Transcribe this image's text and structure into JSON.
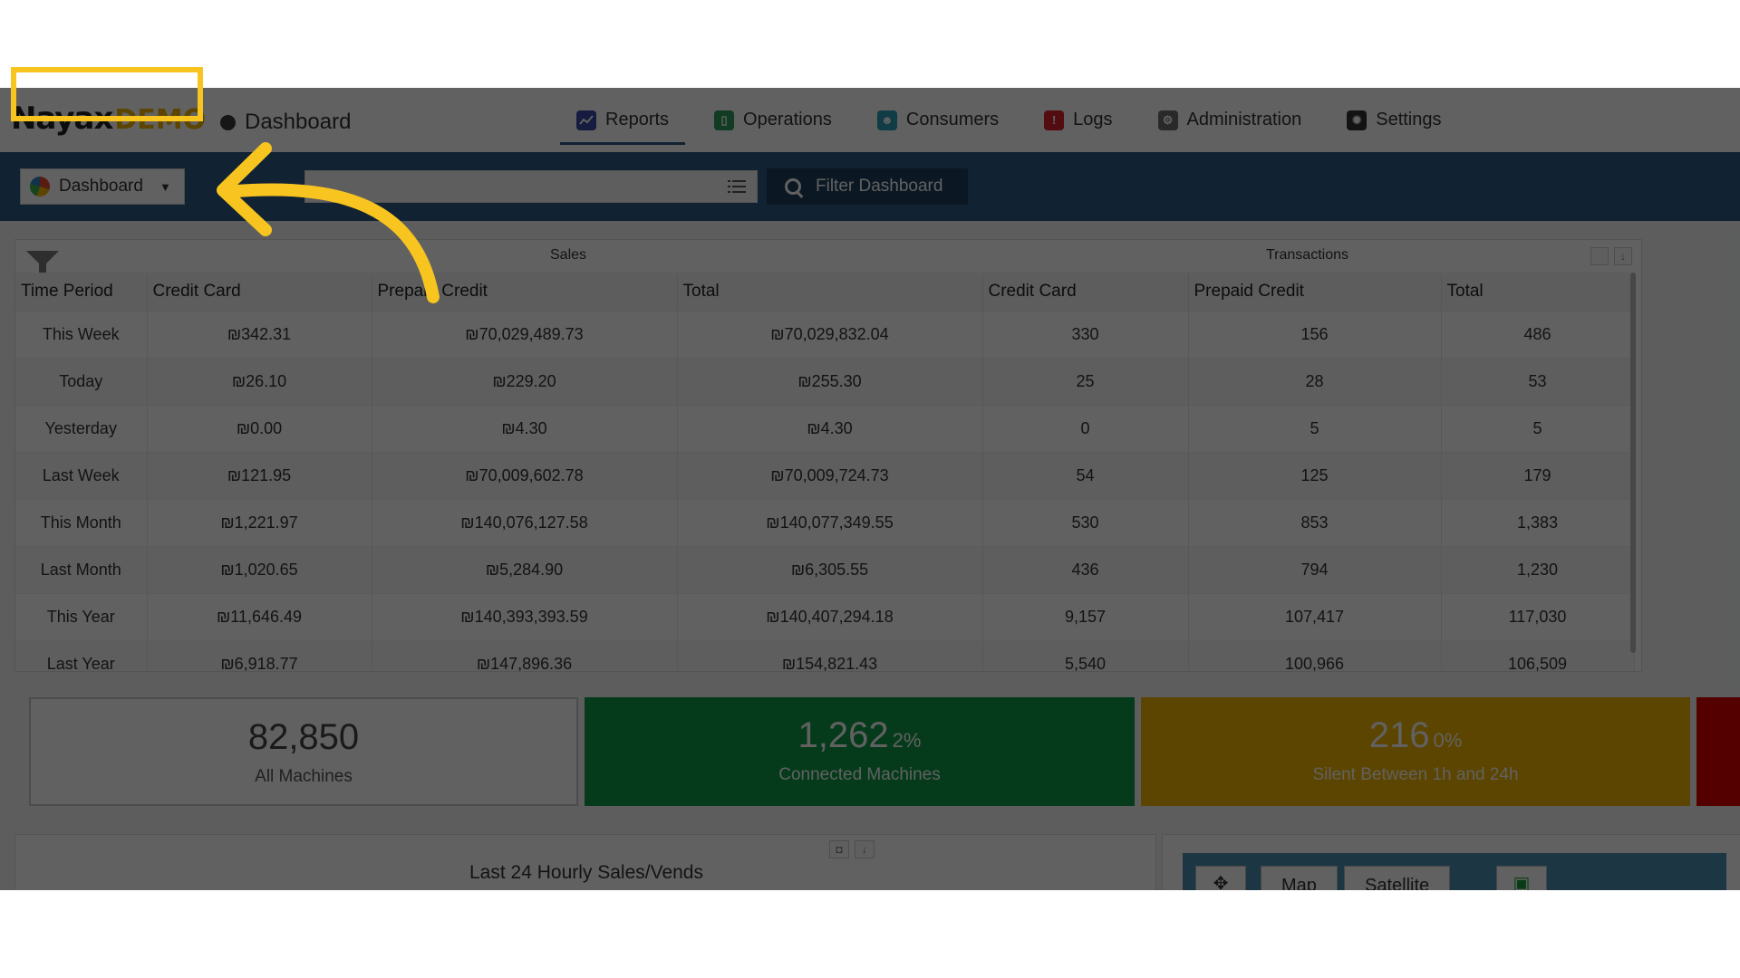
{
  "header": {
    "logo_main": "Nayax",
    "logo_demo": "DEMO",
    "breadcrumb": "Dashboard",
    "nav": [
      {
        "label": "Reports",
        "icon": "reports-icon",
        "color": "#3b4aa8",
        "active": true
      },
      {
        "label": "Operations",
        "icon": "operations-icon",
        "color": "#2d9b5a",
        "active": false
      },
      {
        "label": "Consumers",
        "icon": "consumers-icon",
        "color": "#2a9fb8",
        "active": false
      },
      {
        "label": "Logs",
        "icon": "logs-icon",
        "color": "#d9232d",
        "active": false
      },
      {
        "label": "Administration",
        "icon": "administration-icon",
        "color": "#6d6d6d",
        "active": false
      },
      {
        "label": "Settings",
        "icon": "settings-icon",
        "color": "#333333",
        "active": false
      }
    ]
  },
  "toolbar": {
    "dashboard_select": "Dashboard",
    "search_value": "",
    "filter_label": "Filter Dashboard"
  },
  "table": {
    "groups": {
      "sales": "Sales",
      "transactions": "Transactions"
    },
    "columns": [
      "Time Period",
      "Credit Card",
      "Prepaid Credit",
      "Total",
      "Credit Card",
      "Prepaid Credit",
      "Total"
    ],
    "rows": [
      [
        "This Week",
        "₪342.31",
        "₪70,029,489.73",
        "₪70,029,832.04",
        "330",
        "156",
        "486"
      ],
      [
        "Today",
        "₪26.10",
        "₪229.20",
        "₪255.30",
        "25",
        "28",
        "53"
      ],
      [
        "Yesterday",
        "₪0.00",
        "₪4.30",
        "₪4.30",
        "0",
        "5",
        "5"
      ],
      [
        "Last Week",
        "₪121.95",
        "₪70,009,602.78",
        "₪70,009,724.73",
        "54",
        "125",
        "179"
      ],
      [
        "This Month",
        "₪1,221.97",
        "₪140,076,127.58",
        "₪140,077,349.55",
        "530",
        "853",
        "1,383"
      ],
      [
        "Last Month",
        "₪1,020.65",
        "₪5,284.90",
        "₪6,305.55",
        "436",
        "794",
        "1,230"
      ],
      [
        "This Year",
        "₪11,646.49",
        "₪140,393,393.59",
        "₪140,407,294.18",
        "9,157",
        "107,417",
        "117,030"
      ],
      [
        "Last Year",
        "₪6,918.77",
        "₪147,896.36",
        "₪154,821.43",
        "5,540",
        "100,966",
        "106,509"
      ]
    ]
  },
  "kpis": [
    {
      "value": "82,850",
      "pct": "",
      "label": "All Machines",
      "color": "#ffffff"
    },
    {
      "value": "1,262",
      "pct": "2%",
      "label": "Connected Machines",
      "color": "#0f9b48"
    },
    {
      "value": "216",
      "pct": "0%",
      "label": "Silent Between 1h and 24h",
      "color": "#f2b600"
    }
  ],
  "chart_panel": {
    "title": "Last 24 Hourly Sales/Vends"
  },
  "map_panel": {
    "map_tab": "Map",
    "satellite_tab": "Satellite"
  },
  "colors": {
    "toolbar": "#2e5a86",
    "highlight": "#f7c420"
  }
}
